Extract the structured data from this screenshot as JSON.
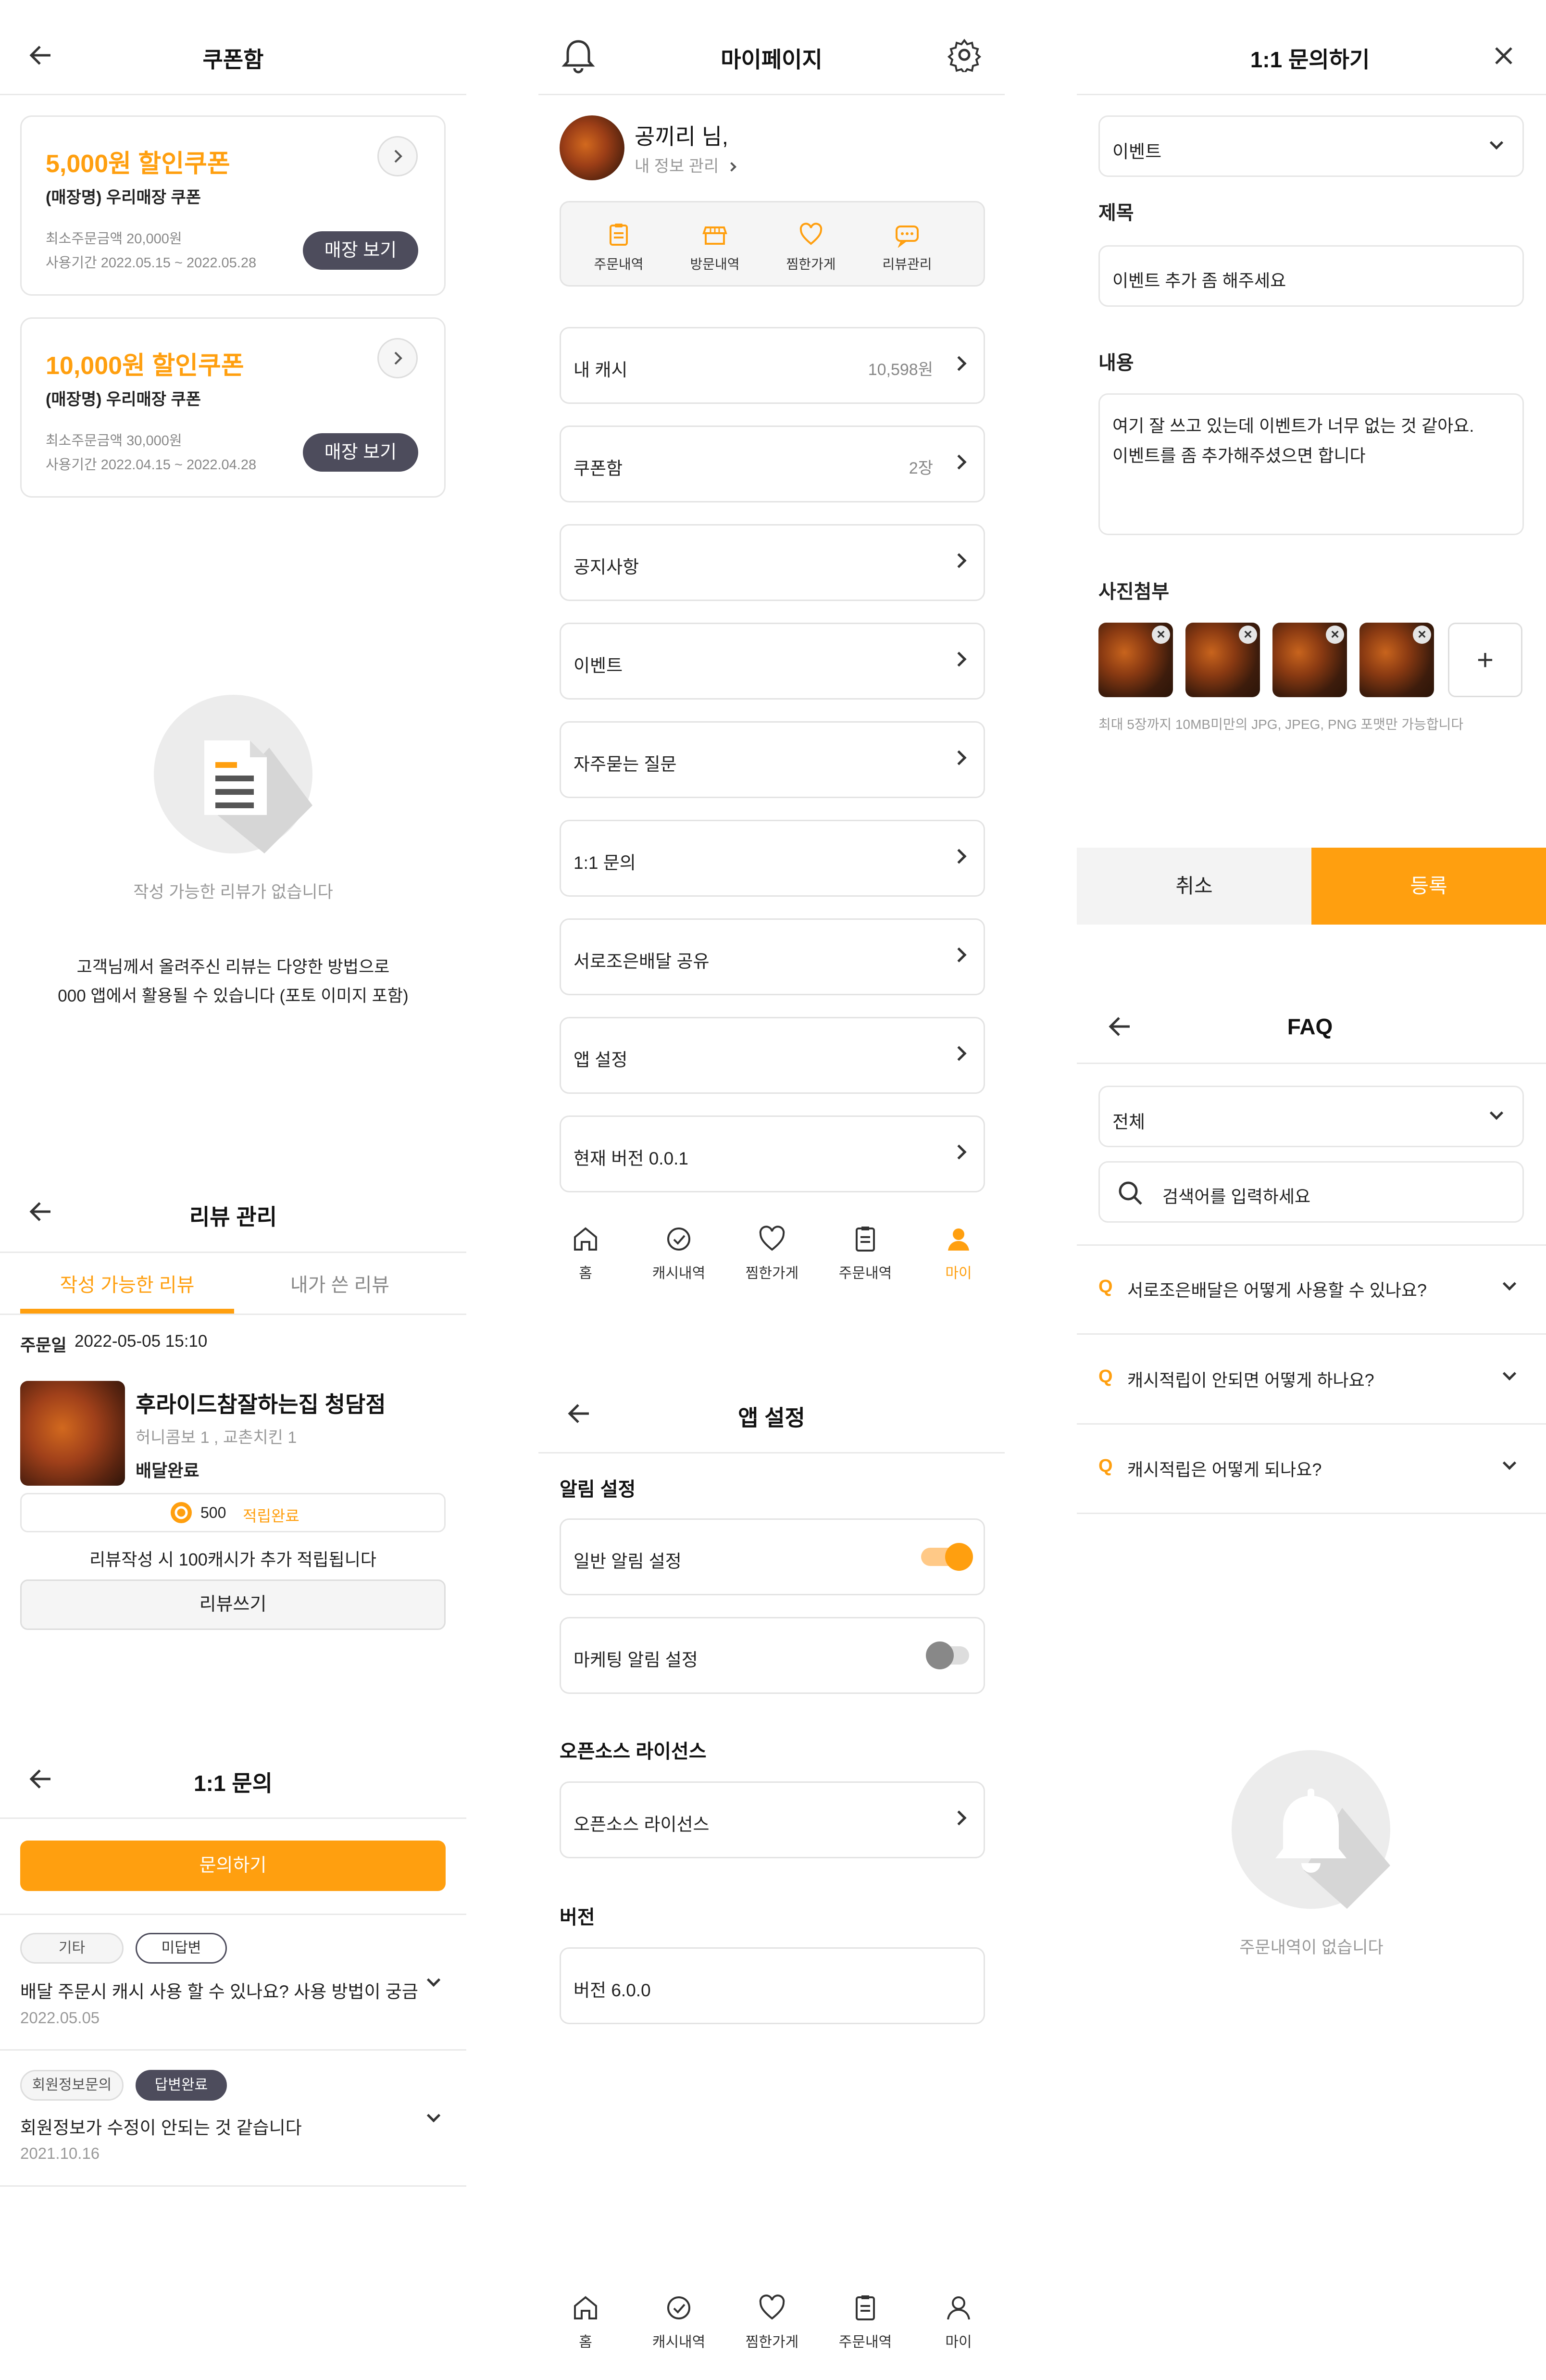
{
  "coupon": {
    "title": "쿠폰함",
    "coupons": [
      {
        "amount": "5,000원 할인쿠폰",
        "store": "(매장명) 우리매장 쿠폰",
        "min": "최소주문금액 20,000원",
        "period": "사용기간 2022.05.15 ~ 2022.05.28",
        "btn": "매장 보기"
      },
      {
        "amount": "10,000원 할인쿠폰",
        "store": "(매장명) 우리매장 쿠폰",
        "min": "최소주문금액 30,000원",
        "period": "사용기간 2022.04.15 ~ 2022.04.28",
        "btn": "매장 보기"
      }
    ],
    "empty_text": "작성 가능한 리뷰가 없습니다",
    "notice_line1": "고객님께서 올려주신 리뷰는 다양한 방법으로",
    "notice_line2": "000 앱에서 활용될 수 있습니다 (포토 이미지 포함)"
  },
  "review": {
    "title": "리뷰 관리",
    "tab_available": "작성 가능한 리뷰",
    "tab_mine": "내가 쓴 리뷰",
    "order_date_label": "주문일",
    "order_date": "2022-05-05 15:10",
    "store": "후라이드참잘하는집 청담점",
    "items": "허니콤보 1 , 교촌치킨 1",
    "status": "배달완료",
    "points": "500",
    "points_status": "적립완료",
    "bonus": "리뷰작성 시 100캐시가 추가 적립됩니다",
    "write_btn": "리뷰쓰기"
  },
  "inquiry_list": {
    "title": "1:1 문의",
    "ask_btn": "문의하기",
    "items": [
      {
        "category": "기타",
        "state": "미답변",
        "question": "배달 주문시 캐시 사용 할 수 있나요? 사용 방법이 궁금…",
        "date": "2022.05.05"
      },
      {
        "category": "회원정보문의",
        "state": "답변완료",
        "question": "회원정보가 수정이 안되는 것 같습니다",
        "date": "2021.10.16"
      }
    ]
  },
  "mypage": {
    "title": "마이페이지",
    "user_name": "공끼리 님,",
    "profile_link": "내 정보 관리",
    "quick": [
      "주문내역",
      "방문내역",
      "찜한가게",
      "리뷰관리"
    ],
    "menu": [
      {
        "label": "내 캐시",
        "value": "10,598원"
      },
      {
        "label": "쿠폰함",
        "value": "2장"
      },
      {
        "label": "공지사항",
        "value": ""
      },
      {
        "label": "이벤트",
        "value": ""
      },
      {
        "label": "자주묻는 질문",
        "value": ""
      },
      {
        "label": "1:1 문의",
        "value": ""
      },
      {
        "label": "서로조은배달 공유",
        "value": ""
      },
      {
        "label": "앱 설정",
        "value": ""
      },
      {
        "label": "현재 버전 0.0.1",
        "value": ""
      }
    ]
  },
  "nav": [
    "홈",
    "캐시내역",
    "찜한가게",
    "주문내역",
    "마이"
  ],
  "settings": {
    "title": "앱 설정",
    "section_alarm": "알림 설정",
    "general": "일반 알림 설정",
    "general_on": true,
    "marketing": "마케팅 알림 설정",
    "marketing_on": false,
    "section_oss": "오픈소스 라이선스",
    "oss_row": "오픈소스 라이선스",
    "section_version": "버전",
    "version": "버전 6.0.0"
  },
  "inquiry_form": {
    "title": "1:1 문의하기",
    "category": "이벤트",
    "subject_label": "제목",
    "subject": "이벤트 추가 좀 해주세요",
    "content_label": "내용",
    "content_line1": "여기 잘 쓰고 있는데 이벤트가 너무 없는 것 같아요.",
    "content_line2": "이벤트를 좀 추가해주셨으면 합니다",
    "photo_label": "사진첨부",
    "photo_hint": "최대 5장까지 10MB미만의 JPG, JPEG, PNG 포맷만 가능합니다",
    "cancel": "취소",
    "submit": "등록"
  },
  "faq": {
    "title": "FAQ",
    "filter": "전체",
    "search_placeholder": "검색어를 입력하세요",
    "questions": [
      "서로조은배달은 어떻게 사용할 수 있나요?",
      "캐시적립이 안되면 어떻게 하나요?",
      "캐시적립은 어떻게 되나요?"
    ],
    "empty_text": "주문내역이 없습니다"
  },
  "colors": {
    "accent": "#ff9f0f",
    "dark": "#4d4c5c"
  }
}
